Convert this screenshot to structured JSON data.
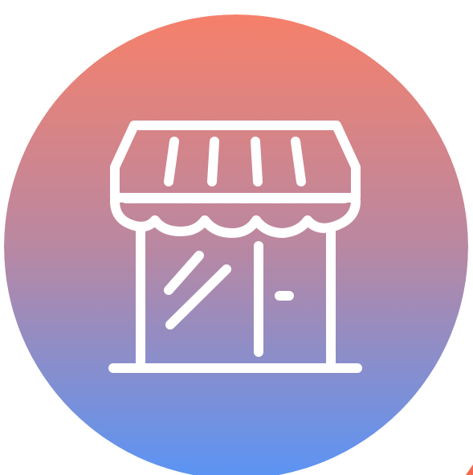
{
  "icon": {
    "name": "storefront-icon",
    "gradient_top": "#F6806A",
    "gradient_mid": "#B988A2",
    "gradient_bottom": "#5A94F5",
    "stroke_color": "#FFFFFF"
  },
  "corner_mark": {
    "color": "#F26B4A"
  }
}
